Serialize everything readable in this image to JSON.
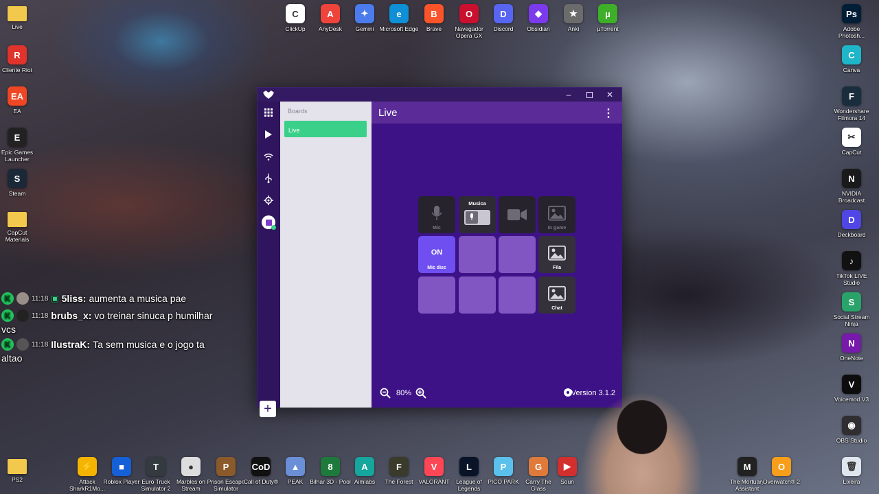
{
  "desktop_left": [
    {
      "label": "Live",
      "name": "live-folder-icon",
      "color": "#f2c94c",
      "glyph": ""
    },
    {
      "label": "Cliente Riot",
      "name": "riot-client-icon",
      "color": "#e0332b",
      "glyph": "R"
    },
    {
      "label": "EA",
      "name": "ea-icon",
      "color": "#ef4623",
      "glyph": "EA"
    },
    {
      "label": "Epic Games Launcher",
      "name": "epic-games-icon",
      "color": "#222222",
      "glyph": "E"
    },
    {
      "label": "Steam",
      "name": "steam-icon",
      "color": "#1b2838",
      "glyph": "S"
    },
    {
      "label": "CapCut Materials",
      "name": "capcut-materials-folder-icon",
      "color": "#f2c94c",
      "glyph": ""
    }
  ],
  "desktop_top": [
    {
      "label": "ClickUp",
      "name": "clickup-icon",
      "color": "#ffffff",
      "glyph": "C"
    },
    {
      "label": "AnyDesk",
      "name": "anydesk-icon",
      "color": "#ef443b",
      "glyph": "A"
    },
    {
      "label": "Gemini",
      "name": "gemini-icon",
      "color": "#4b7bec",
      "glyph": "✦"
    },
    {
      "label": "Microsoft Edge",
      "name": "edge-icon",
      "color": "#0f8fd6",
      "glyph": "e"
    },
    {
      "label": "Brave",
      "name": "brave-icon",
      "color": "#fb542b",
      "glyph": "B"
    },
    {
      "label": "Navegador Opera GX",
      "name": "opera-gx-icon",
      "color": "#c9102e",
      "glyph": "O"
    },
    {
      "label": "Discord",
      "name": "discord-icon",
      "color": "#5865f2",
      "glyph": "D"
    },
    {
      "label": "Obsidian",
      "name": "obsidian-icon",
      "color": "#7c3aed",
      "glyph": "◆"
    },
    {
      "label": "Anki",
      "name": "anki-icon",
      "color": "#6b6b6b",
      "glyph": "★"
    },
    {
      "label": "µTorrent",
      "name": "utorrent-icon",
      "color": "#3fae29",
      "glyph": "µ"
    }
  ],
  "desktop_right": [
    {
      "label": "Adobe Photosh...",
      "name": "photoshop-icon",
      "color": "#001e36",
      "glyph": "Ps"
    },
    {
      "label": "Canva",
      "name": "canva-icon",
      "color": "#1fb6c9",
      "glyph": "C"
    },
    {
      "label": "Wondershare Filmora 14",
      "name": "filmora-icon",
      "color": "#1a2d3d",
      "glyph": "F"
    },
    {
      "label": "CapCut",
      "name": "capcut-icon",
      "color": "#ffffff",
      "glyph": "✂"
    },
    {
      "label": "NVIDIA Broadcast",
      "name": "nvidia-broadcast-icon",
      "color": "#1a1a1a",
      "glyph": "N"
    },
    {
      "label": "Deckboard",
      "name": "deckboard-icon",
      "color": "#4f46e5",
      "glyph": "D"
    },
    {
      "label": "TikTok LIVE Studio",
      "name": "tiktok-live-icon",
      "color": "#111111",
      "glyph": "♪"
    },
    {
      "label": "Social Stream Ninja",
      "name": "social-stream-ninja-icon",
      "color": "#2aa36b",
      "glyph": "S"
    },
    {
      "label": "OneNote",
      "name": "onenote-icon",
      "color": "#7719aa",
      "glyph": "N"
    },
    {
      "label": "Voicemod V3",
      "name": "voicemod-icon",
      "color": "#0d0d0d",
      "glyph": "V"
    },
    {
      "label": "OBS Studio",
      "name": "obs-icon",
      "color": "#302e31",
      "glyph": "◉"
    },
    {
      "label": "Lixeira",
      "name": "recycle-bin-icon",
      "color": "#dfe6ee",
      "glyph": "🗑"
    }
  ],
  "taskbar_icons": [
    {
      "label": "PS2",
      "name": "ps2-folder-icon",
      "color": "#f2c94c",
      "glyph": ""
    },
    {
      "label": "Attack SharkR1Mo...",
      "name": "attack-shark-icon",
      "color": "#f4b400",
      "glyph": "⚡"
    },
    {
      "label": "Roblox Player",
      "name": "roblox-icon",
      "color": "#1560d6",
      "glyph": "■"
    },
    {
      "label": "Euro Truck Simulator 2",
      "name": "euro-truck-icon",
      "color": "#333a40",
      "glyph": "T"
    },
    {
      "label": "Marbles on Stream",
      "name": "marbles-icon",
      "color": "#dddddd",
      "glyph": "●"
    },
    {
      "label": "Prison Escape Simulator",
      "name": "prison-escape-icon",
      "color": "#8b5a2b",
      "glyph": "P"
    },
    {
      "label": "Call of Duty®",
      "name": "call-of-duty-icon",
      "color": "#111111",
      "glyph": "CoD"
    },
    {
      "label": "PEAK",
      "name": "peak-icon",
      "color": "#6b8fd6",
      "glyph": "▲"
    },
    {
      "label": "Bilhar 3D - Pool",
      "name": "bilhar-icon",
      "color": "#1e7a3a",
      "glyph": "8"
    },
    {
      "label": "Aimlabs",
      "name": "aimlabs-icon",
      "color": "#15a69d",
      "glyph": "A"
    },
    {
      "label": "The Forest",
      "name": "the-forest-icon",
      "color": "#3b3b2b",
      "glyph": "F"
    },
    {
      "label": "VALORANT",
      "name": "valorant-icon",
      "color": "#ff4655",
      "glyph": "V"
    },
    {
      "label": "League of Legends",
      "name": "league-icon",
      "color": "#0a1428",
      "glyph": "L"
    },
    {
      "label": "PICO PARK",
      "name": "pico-park-icon",
      "color": "#5bc0eb",
      "glyph": "P"
    },
    {
      "label": "Carry The Glass",
      "name": "carry-the-glass-icon",
      "color": "#e07a3a",
      "glyph": "G"
    },
    {
      "label": "Soun",
      "name": "soundpad-icon",
      "color": "#d32f2f",
      "glyph": "▶"
    }
  ],
  "taskbar_right": [
    {
      "label": "The Mortuary Assistant",
      "name": "mortuary-assistant-icon",
      "color": "#222222",
      "glyph": "M"
    },
    {
      "label": "Overwatch® 2",
      "name": "overwatch-icon",
      "color": "#f99e1a",
      "glyph": "O"
    }
  ],
  "chat": [
    {
      "time": "11:18",
      "user": "5liss:",
      "message": "aumenta a musica pae",
      "cont": ""
    },
    {
      "time": "11:18",
      "user": "brubs_x:",
      "message": "vo treinar sinuca p humilhar",
      "cont": "vcs"
    },
    {
      "time": "11:18",
      "user": "IlustraK:",
      "message": "Ta sem musica e o jogo ta",
      "cont": "altao"
    }
  ],
  "app": {
    "boards_header": "Boards",
    "board_item": "Live",
    "board_title": "Live",
    "add_label": "+",
    "zoom": "80%",
    "version": "Version 3.1.2",
    "cells": {
      "mic": "Mic",
      "musica": "Musica",
      "in_game": "In game",
      "on": "ON",
      "mic_disc": "Mic disc",
      "fila": "Fila",
      "chat": "Chat"
    }
  }
}
